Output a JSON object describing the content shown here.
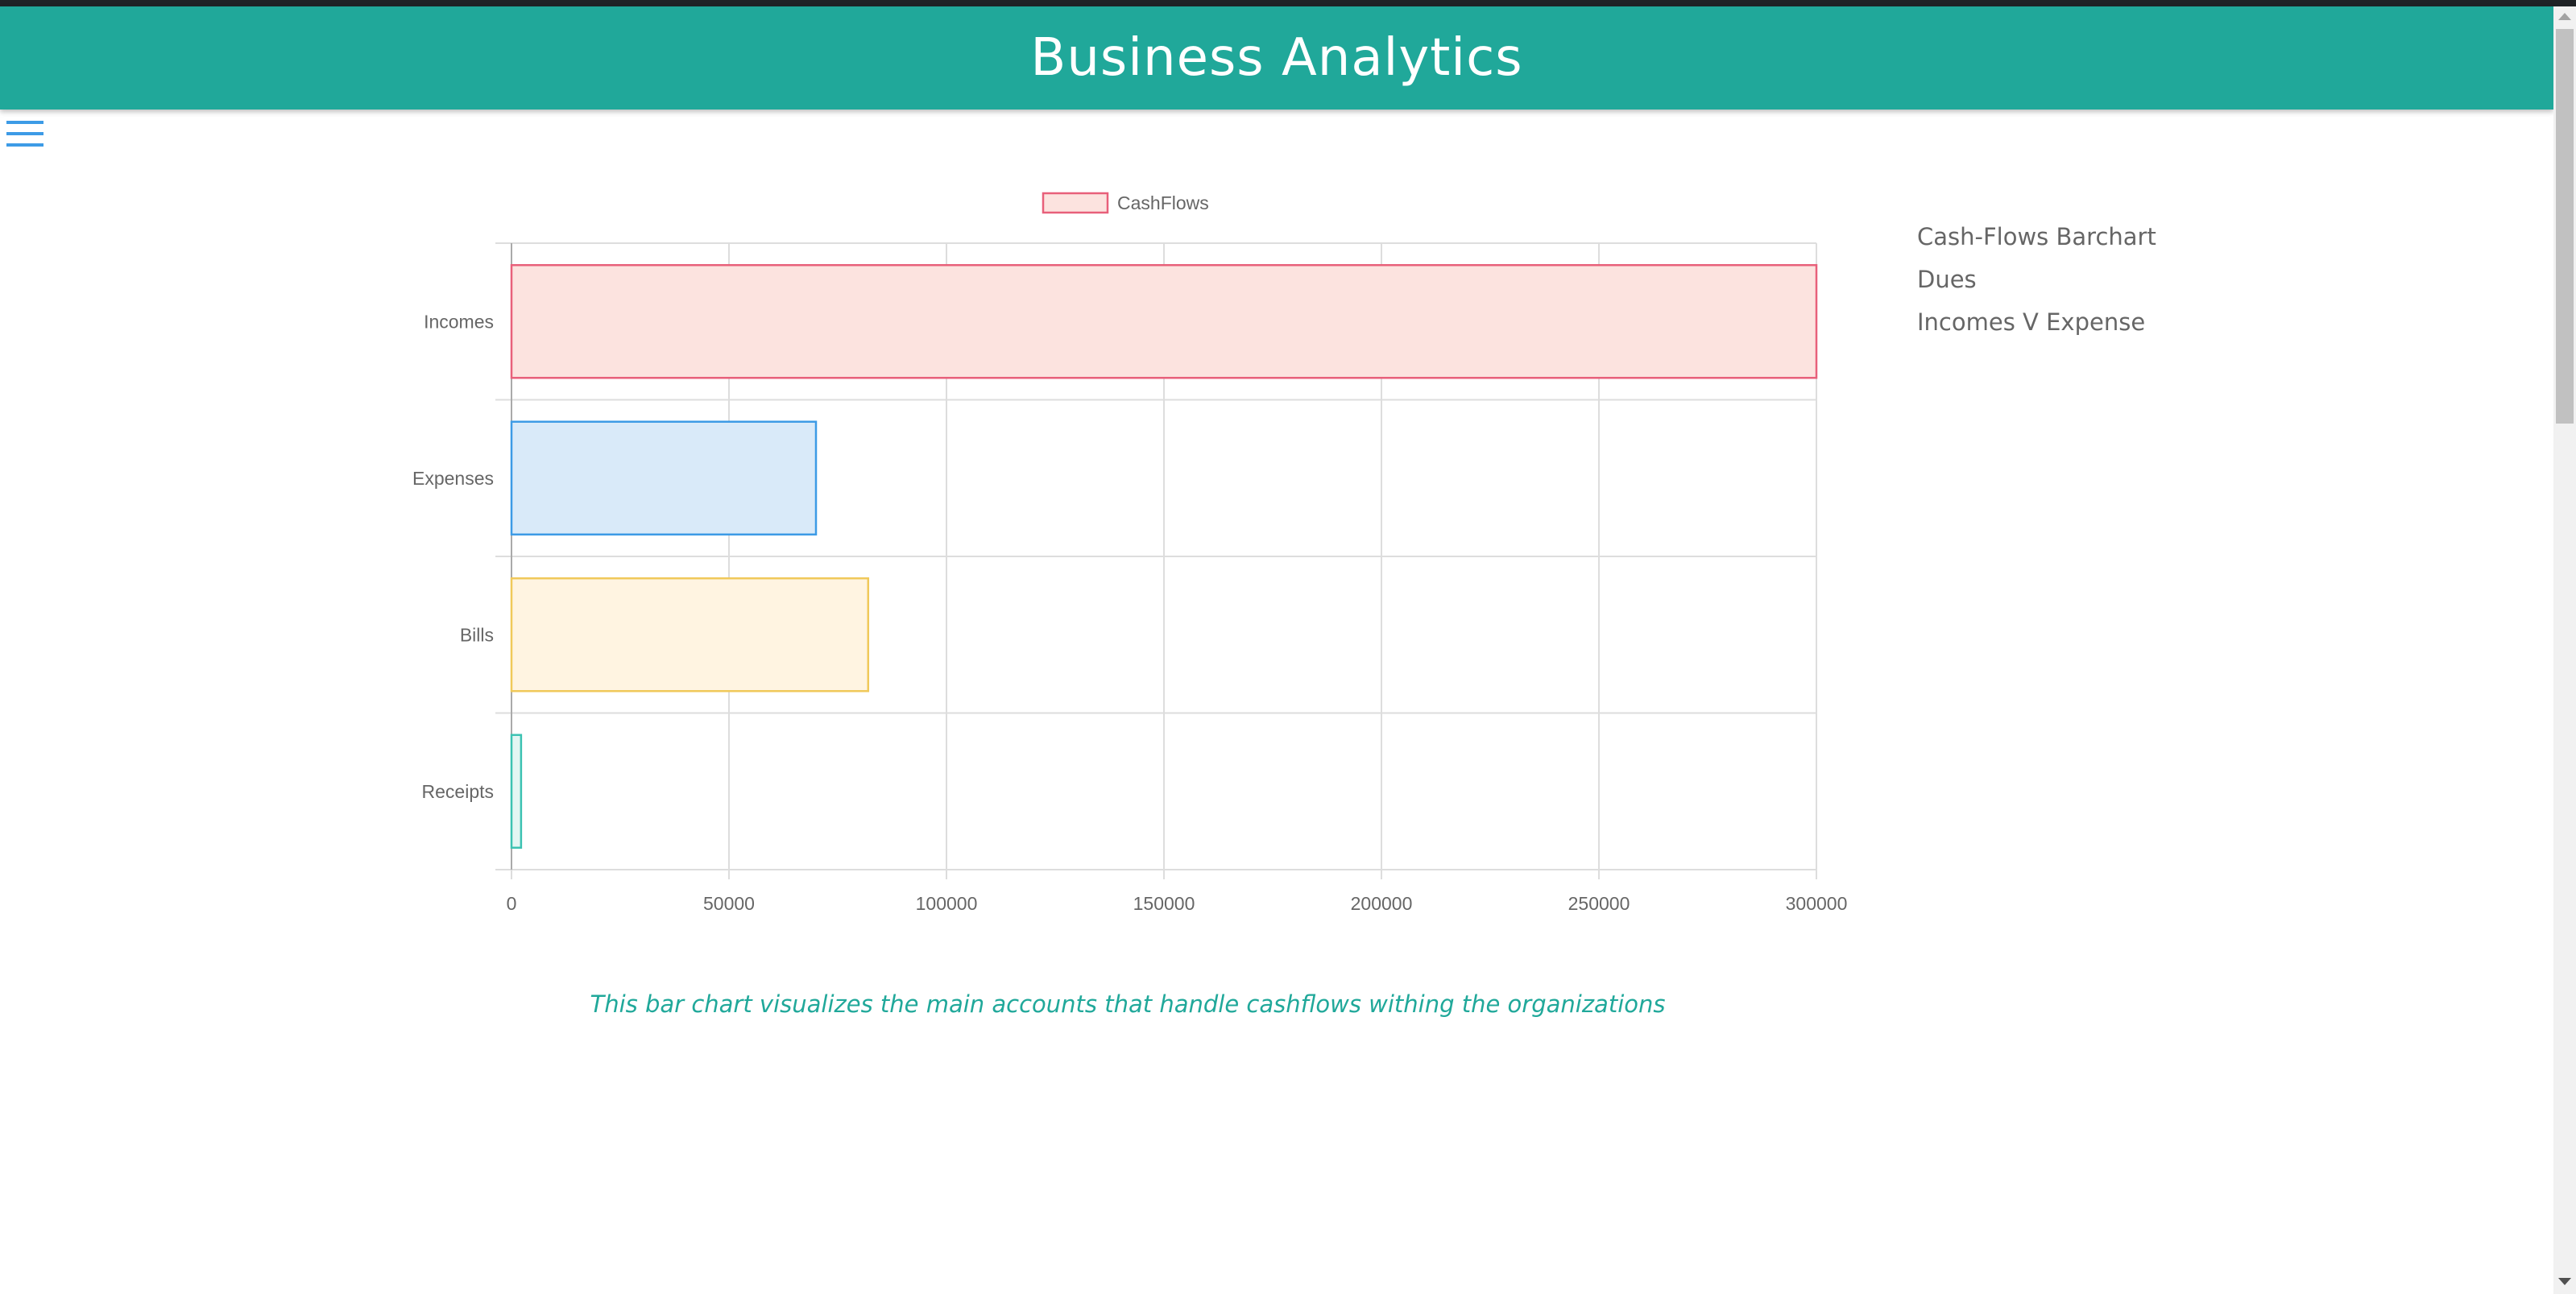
{
  "header": {
    "title": "Business Analytics"
  },
  "side_nav": {
    "items": [
      {
        "label": "Cash-Flows Barchart"
      },
      {
        "label": "Dues"
      },
      {
        "label": "Incomes V Expense"
      }
    ]
  },
  "caption": "This bar chart visualizes the main accounts that handle cashflows withing the organizations",
  "colors": {
    "header_bg": "#20a89a",
    "accent_text": "#20a89a"
  },
  "chart_data": {
    "type": "bar",
    "orientation": "horizontal",
    "legend": {
      "label": "CashFlows",
      "position": "top"
    },
    "categories": [
      "Incomes",
      "Expenses",
      "Bills",
      "Receipts"
    ],
    "series": [
      {
        "name": "CashFlows",
        "values": [
          300000,
          70000,
          82000,
          2200
        ]
      }
    ],
    "bar_colors": [
      {
        "fill": "#fce3df",
        "stroke": "#e8607a"
      },
      {
        "fill": "#d9eaf9",
        "stroke": "#3d9be6"
      },
      {
        "fill": "#fff4e1",
        "stroke": "#f0c95a"
      },
      {
        "fill": "#e3f6f3",
        "stroke": "#3cc2b2"
      }
    ],
    "x_ticks": [
      "0",
      "50000",
      "100000",
      "150000",
      "200000",
      "250000",
      "300000"
    ],
    "xlim": [
      0,
      300000
    ],
    "grid": true
  }
}
